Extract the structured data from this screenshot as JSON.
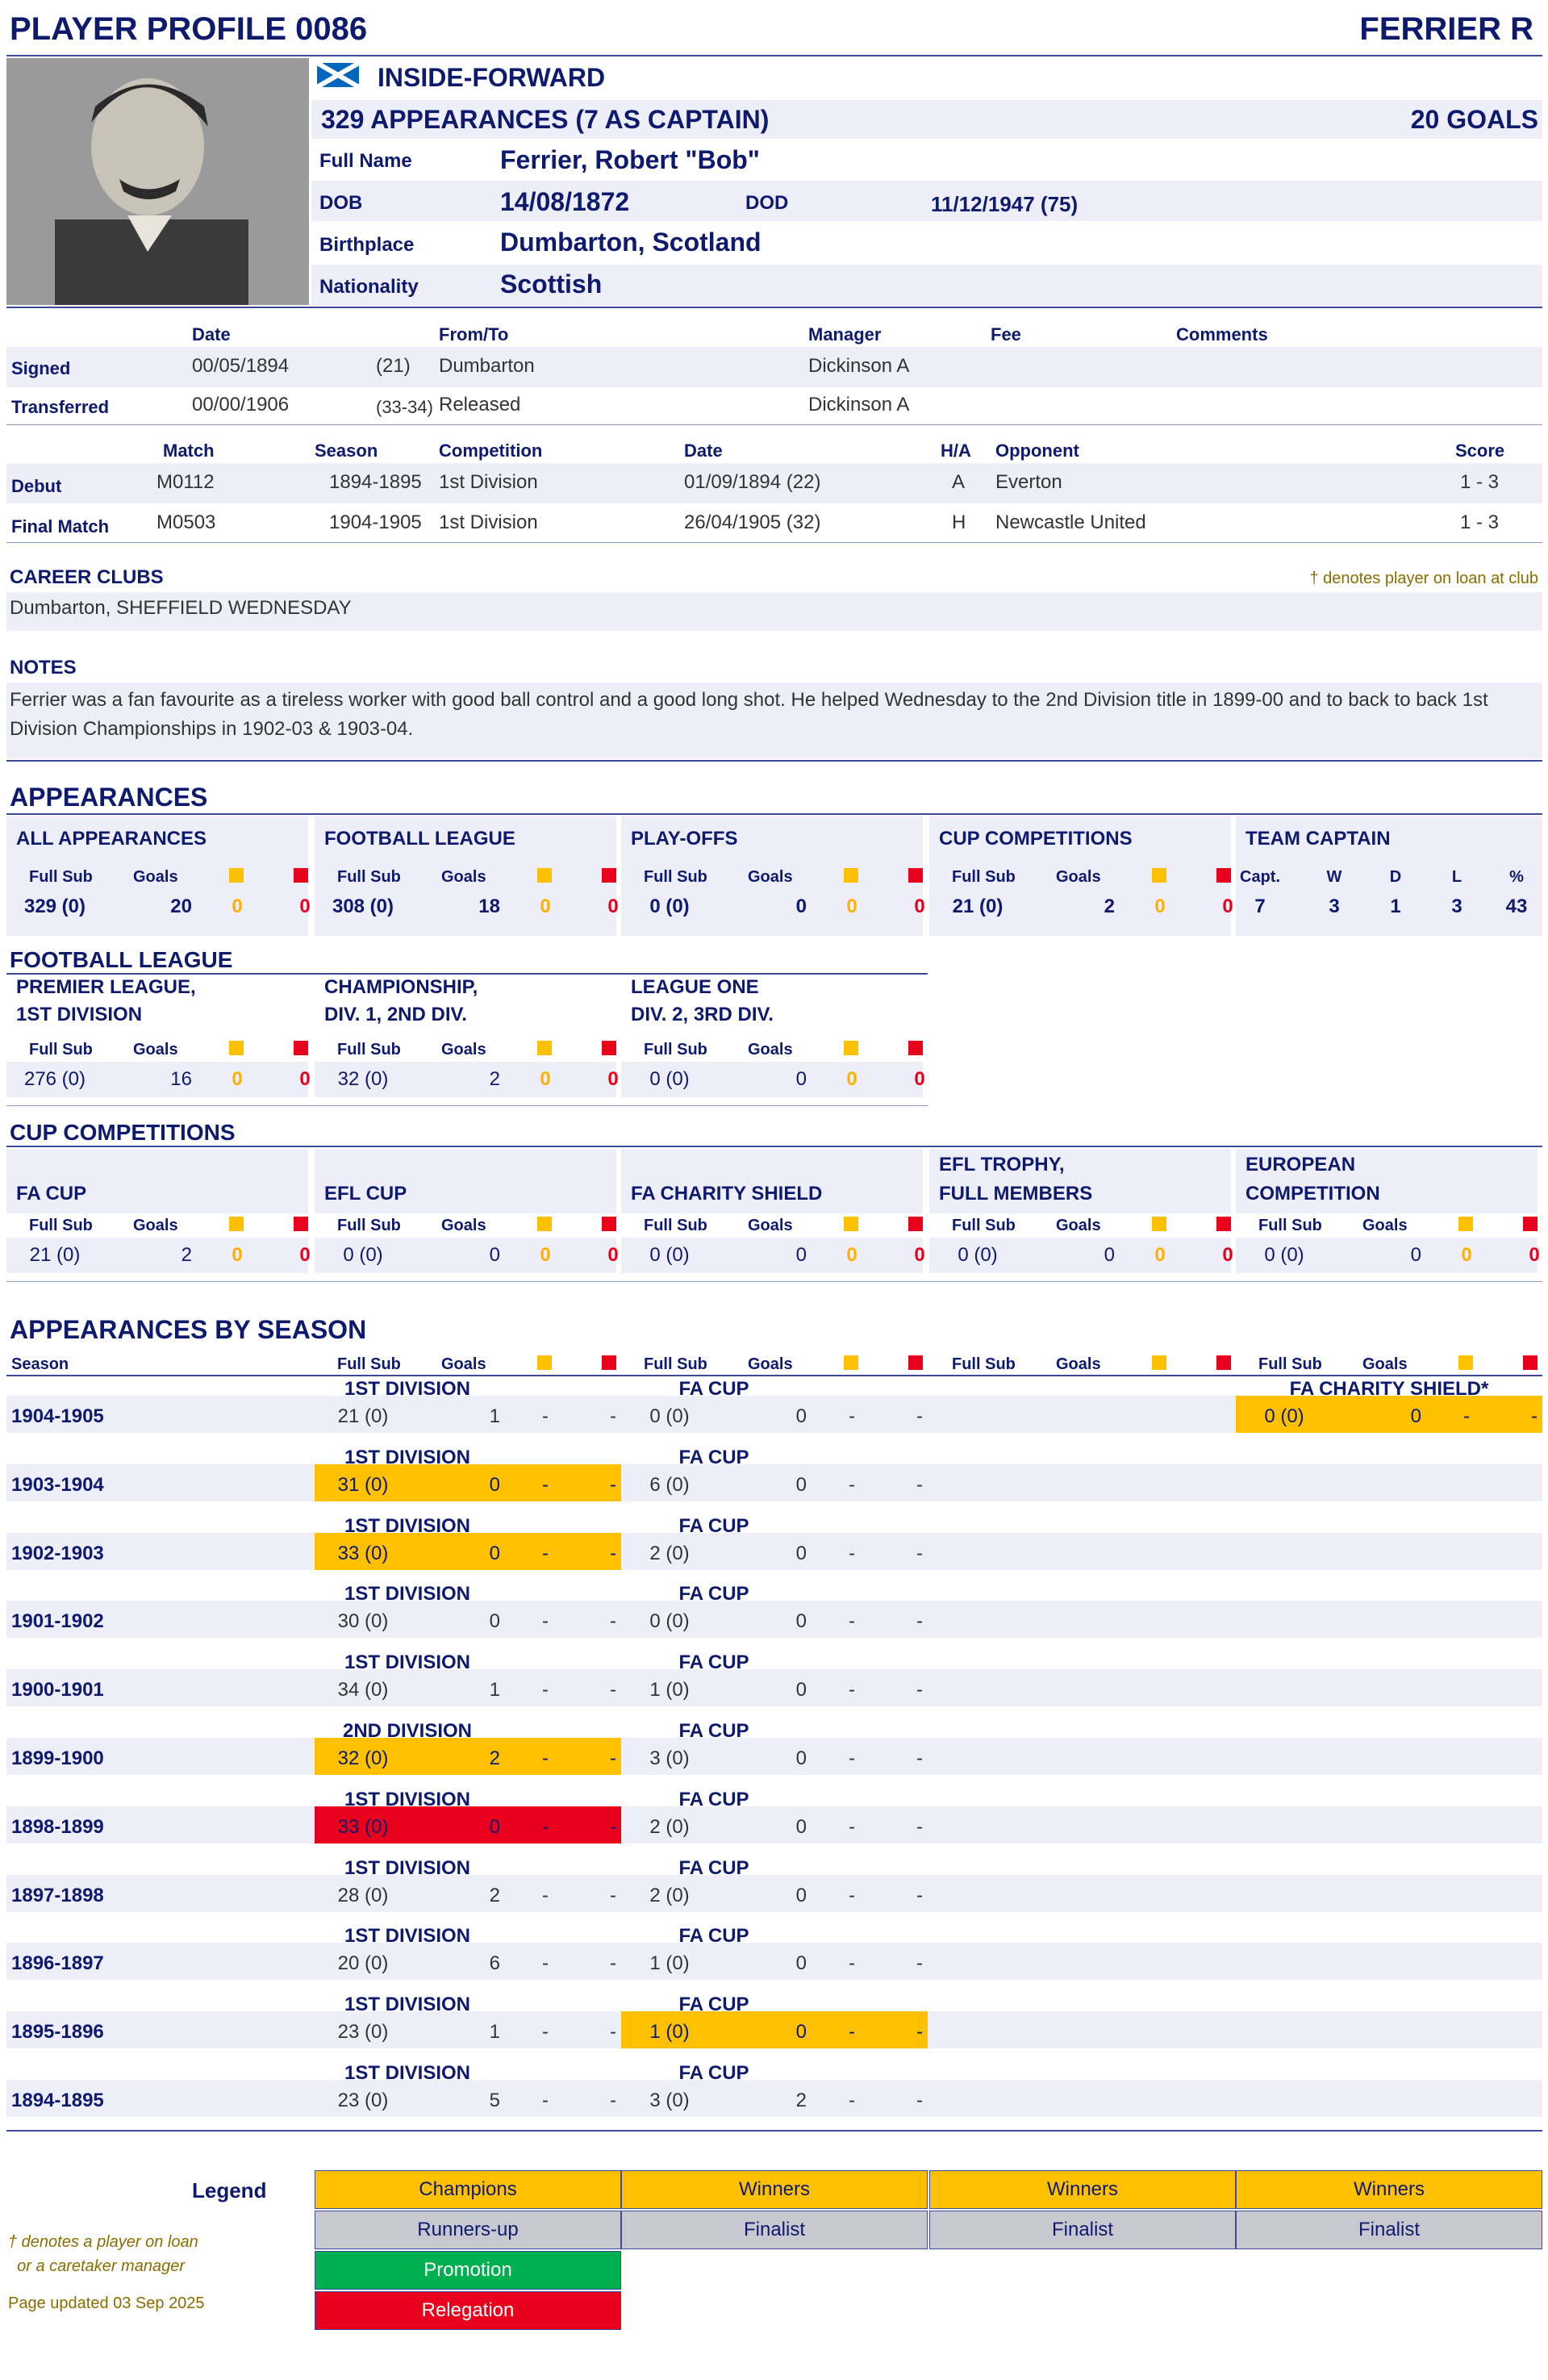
{
  "header": {
    "title": "PLAYER PROFILE 0086",
    "name_short": "FERRIER R"
  },
  "profile": {
    "position": "INSIDE-FORWARD",
    "appearances_line": "329 APPEARANCES (7 AS CAPTAIN)",
    "goals_line": "20 GOALS",
    "full_name_label": "Full Name",
    "full_name": "Ferrier, Robert \"Bob\"",
    "dob_label": "DOB",
    "dob": "14/08/1872",
    "dod_label": "DOD",
    "dod": "11/12/1947  (75)",
    "birthplace_label": "Birthplace",
    "birthplace": "Dumbarton, Scotland",
    "nationality_label": "Nationality",
    "nationality": "Scottish"
  },
  "transfers": {
    "headers": [
      "Date",
      "From/To",
      "Manager",
      "Fee",
      "Comments"
    ],
    "rows": [
      {
        "label": "Signed",
        "date": "00/05/1894",
        "age": "(21)",
        "club": "Dumbarton",
        "manager": "Dickinson A"
      },
      {
        "label": "Transferred",
        "date": "00/00/1906",
        "age": "(33-34)",
        "club": "Released",
        "manager": "Dickinson A"
      }
    ]
  },
  "matches": {
    "headers": [
      "Match",
      "Season",
      "Competition",
      "Date",
      "H/A",
      "Opponent",
      "Score"
    ],
    "rows": [
      {
        "label": "Debut",
        "match": "M0112",
        "season": "1894-1895",
        "competition": "1st Division",
        "date": "01/09/1894 (22)",
        "ha": "A",
        "opponent": "Everton",
        "score": "1 - 3"
      },
      {
        "label": "Final Match",
        "match": "M0503",
        "season": "1904-1905",
        "competition": "1st Division",
        "date": "26/04/1905 (32)",
        "ha": "H",
        "opponent": "Newcastle United",
        "score": "1 - 3"
      }
    ]
  },
  "career": {
    "title": "CAREER CLUBS",
    "note": "† denotes player on loan at club",
    "clubs": "Dumbarton, SHEFFIELD WEDNESDAY"
  },
  "notes": {
    "title": "NOTES",
    "text": "Ferrier was a fan favourite as a tireless worker with good ball control and a good long shot.  He helped Wednesday to the 2nd Division title in 1899-00 and to back to back 1st Division Championships in 1902-03 & 1903-04."
  },
  "appearances": {
    "title": "APPEARANCES",
    "cols": {
      "fullsub": "Full Sub",
      "goals": "Goals"
    },
    "blocks": [
      {
        "title": "ALL APPEARANCES",
        "app": "329 (0)",
        "goals": "20",
        "y": "0",
        "r": "0"
      },
      {
        "title": "FOOTBALL LEAGUE",
        "app": "308 (0)",
        "goals": "18",
        "y": "0",
        "r": "0"
      },
      {
        "title": "PLAY-OFFS",
        "app": "0 (0)",
        "goals": "0",
        "y": "0",
        "r": "0"
      },
      {
        "title": "CUP COMPETITIONS",
        "app": "21 (0)",
        "goals": "2",
        "y": "0",
        "r": "0"
      }
    ],
    "captain": {
      "title": "TEAM CAPTAIN",
      "headers": [
        "Capt.",
        "W",
        "D",
        "L",
        "%"
      ],
      "values": [
        "7",
        "3",
        "1",
        "3",
        "43"
      ]
    }
  },
  "league": {
    "title": "FOOTBALL LEAGUE",
    "blocks": [
      {
        "title1": "PREMIER LEAGUE,",
        "title2": "1ST DIVISION",
        "app": "276 (0)",
        "goals": "16",
        "y": "0",
        "r": "0"
      },
      {
        "title1": "CHAMPIONSHIP,",
        "title2": "DIV. 1, 2ND DIV.",
        "app": "32 (0)",
        "goals": "2",
        "y": "0",
        "r": "0"
      },
      {
        "title1": "LEAGUE ONE",
        "title2": "DIV. 2, 3RD DIV.",
        "app": "0 (0)",
        "goals": "0",
        "y": "0",
        "r": "0"
      }
    ]
  },
  "cups": {
    "title": "CUP COMPETITIONS",
    "blocks": [
      {
        "title1": "",
        "title2": "FA CUP",
        "app": "21 (0)",
        "goals": "2",
        "y": "0",
        "r": "0"
      },
      {
        "title1": "",
        "title2": "EFL CUP",
        "app": "0 (0)",
        "goals": "0",
        "y": "0",
        "r": "0"
      },
      {
        "title1": "",
        "title2": "FA CHARITY SHIELD",
        "app": "0 (0)",
        "goals": "0",
        "y": "0",
        "r": "0"
      },
      {
        "title1": "EFL TROPHY,",
        "title2": "FULL MEMBERS",
        "app": "0 (0)",
        "goals": "0",
        "y": "0",
        "r": "0"
      },
      {
        "title1": "EUROPEAN",
        "title2": "COMPETITION",
        "app": "0 (0)",
        "goals": "0",
        "y": "0",
        "r": "0"
      }
    ]
  },
  "seasons": {
    "title": "APPEARANCES BY SEASON",
    "season_label": "Season",
    "rows": [
      {
        "season": "1904-1905",
        "comp1": "1ST DIVISION",
        "a1": "21 (0)",
        "g1": "1",
        "y1": "-",
        "r1": "-",
        "hl1": "",
        "comp2": "FA CUP",
        "a2": "0 (0)",
        "g2": "0",
        "y2": "-",
        "r2": "-",
        "hl2": "",
        "comp5": "FA CHARITY SHIELD*",
        "a5": "0 (0)",
        "g5": "0",
        "y5": "-",
        "r5": "-",
        "hl5": "gold"
      },
      {
        "season": "1903-1904",
        "comp1": "1ST DIVISION",
        "a1": "31 (0)",
        "g1": "0",
        "y1": "-",
        "r1": "-",
        "hl1": "gold",
        "comp2": "FA CUP",
        "a2": "6 (0)",
        "g2": "0",
        "y2": "-",
        "r2": "-",
        "hl2": ""
      },
      {
        "season": "1902-1903",
        "comp1": "1ST DIVISION",
        "a1": "33 (0)",
        "g1": "0",
        "y1": "-",
        "r1": "-",
        "hl1": "gold",
        "comp2": "FA CUP",
        "a2": "2 (0)",
        "g2": "0",
        "y2": "-",
        "r2": "-",
        "hl2": ""
      },
      {
        "season": "1901-1902",
        "comp1": "1ST DIVISION",
        "a1": "30 (0)",
        "g1": "0",
        "y1": "-",
        "r1": "-",
        "hl1": "",
        "comp2": "FA CUP",
        "a2": "0 (0)",
        "g2": "0",
        "y2": "-",
        "r2": "-",
        "hl2": ""
      },
      {
        "season": "1900-1901",
        "comp1": "1ST DIVISION",
        "a1": "34 (0)",
        "g1": "1",
        "y1": "-",
        "r1": "-",
        "hl1": "",
        "comp2": "FA CUP",
        "a2": "1 (0)",
        "g2": "0",
        "y2": "-",
        "r2": "-",
        "hl2": ""
      },
      {
        "season": "1899-1900",
        "comp1": "2ND DIVISION",
        "a1": "32 (0)",
        "g1": "2",
        "y1": "-",
        "r1": "-",
        "hl1": "gold",
        "comp2": "FA CUP",
        "a2": "3 (0)",
        "g2": "0",
        "y2": "-",
        "r2": "-",
        "hl2": ""
      },
      {
        "season": "1898-1899",
        "comp1": "1ST DIVISION",
        "a1": "33 (0)",
        "g1": "0",
        "y1": "-",
        "r1": "-",
        "hl1": "red",
        "comp2": "FA CUP",
        "a2": "2 (0)",
        "g2": "0",
        "y2": "-",
        "r2": "-",
        "hl2": ""
      },
      {
        "season": "1897-1898",
        "comp1": "1ST DIVISION",
        "a1": "28 (0)",
        "g1": "2",
        "y1": "-",
        "r1": "-",
        "hl1": "",
        "comp2": "FA CUP",
        "a2": "2 (0)",
        "g2": "0",
        "y2": "-",
        "r2": "-",
        "hl2": ""
      },
      {
        "season": "1896-1897",
        "comp1": "1ST DIVISION",
        "a1": "20 (0)",
        "g1": "6",
        "y1": "-",
        "r1": "-",
        "hl1": "",
        "comp2": "FA CUP",
        "a2": "1 (0)",
        "g2": "0",
        "y2": "-",
        "r2": "-",
        "hl2": ""
      },
      {
        "season": "1895-1896",
        "comp1": "1ST DIVISION",
        "a1": "23 (0)",
        "g1": "1",
        "y1": "-",
        "r1": "-",
        "hl1": "",
        "comp2": "FA CUP",
        "a2": "1 (0)",
        "g2": "0",
        "y2": "-",
        "r2": "-",
        "hl2": "gold"
      },
      {
        "season": "1894-1895",
        "comp1": "1ST DIVISION",
        "a1": "23 (0)",
        "g1": "5",
        "y1": "-",
        "r1": "-",
        "hl1": "",
        "comp2": "FA CUP",
        "a2": "3 (0)",
        "g2": "2",
        "y2": "-",
        "r2": "-",
        "hl2": ""
      }
    ]
  },
  "legend": {
    "title": "Legend",
    "champions": "Champions",
    "winners": "Winners",
    "runners_up": "Runners-up",
    "finalist": "Finalist",
    "promotion": "Promotion",
    "relegation": "Relegation",
    "note1": "† denotes a player on loan",
    "note2": "  or a caretaker manager",
    "updated": "Page updated 03 Sep 2025"
  },
  "colors": {
    "navy": "#0d1a6e",
    "gold": "#ffc000",
    "red": "#e8001c",
    "green": "#00b050",
    "grey": "#c8c8d0",
    "band": "#eeeef8"
  }
}
